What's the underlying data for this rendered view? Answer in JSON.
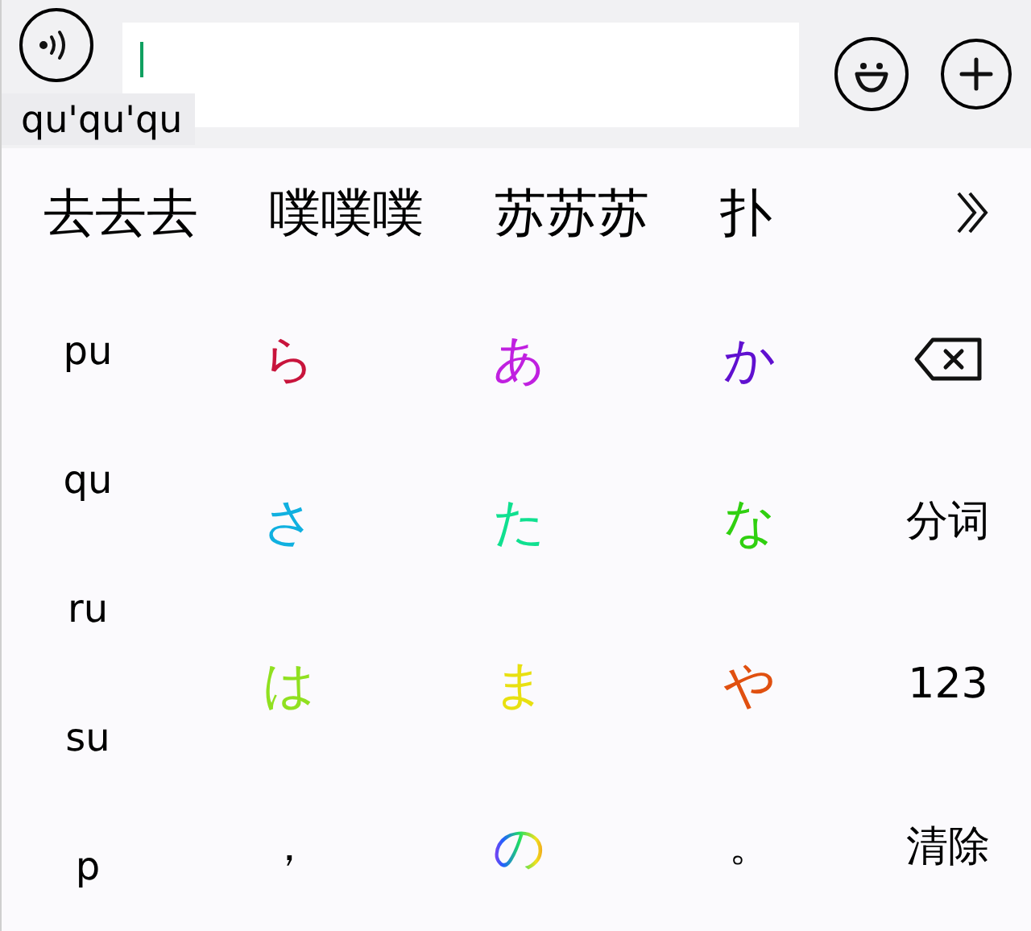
{
  "composition": {
    "text": "qu'qu'qu"
  },
  "candidates": [
    "去去去",
    "噗噗噗",
    "苏苏苏",
    "扑"
  ],
  "pinyin": [
    "pu",
    "qu",
    "ru",
    "su",
    "p"
  ],
  "keys": [
    {
      "kind": "kana",
      "label": "ら",
      "color": "#c8143c"
    },
    {
      "kind": "kana",
      "label": "あ",
      "color": "#c020e0"
    },
    {
      "kind": "kana",
      "label": "か",
      "color": "#6010d0"
    },
    {
      "kind": "backspace"
    },
    {
      "kind": "kana",
      "label": "さ",
      "color": "#10b0e0"
    },
    {
      "kind": "kana",
      "label": "た",
      "color": "#10e090"
    },
    {
      "kind": "kana",
      "label": "な",
      "color": "#30d010"
    },
    {
      "kind": "text",
      "label": "分词"
    },
    {
      "kind": "kana",
      "label": "は",
      "color": "#90e020"
    },
    {
      "kind": "kana",
      "label": "ま",
      "color": "#e8e010"
    },
    {
      "kind": "kana",
      "label": "や",
      "color": "#e05010"
    },
    {
      "kind": "text",
      "label": "123"
    },
    {
      "kind": "text",
      "label": "，"
    },
    {
      "kind": "rainbow",
      "label": "の"
    },
    {
      "kind": "text",
      "label": "。"
    },
    {
      "kind": "text",
      "label": "清除"
    }
  ]
}
